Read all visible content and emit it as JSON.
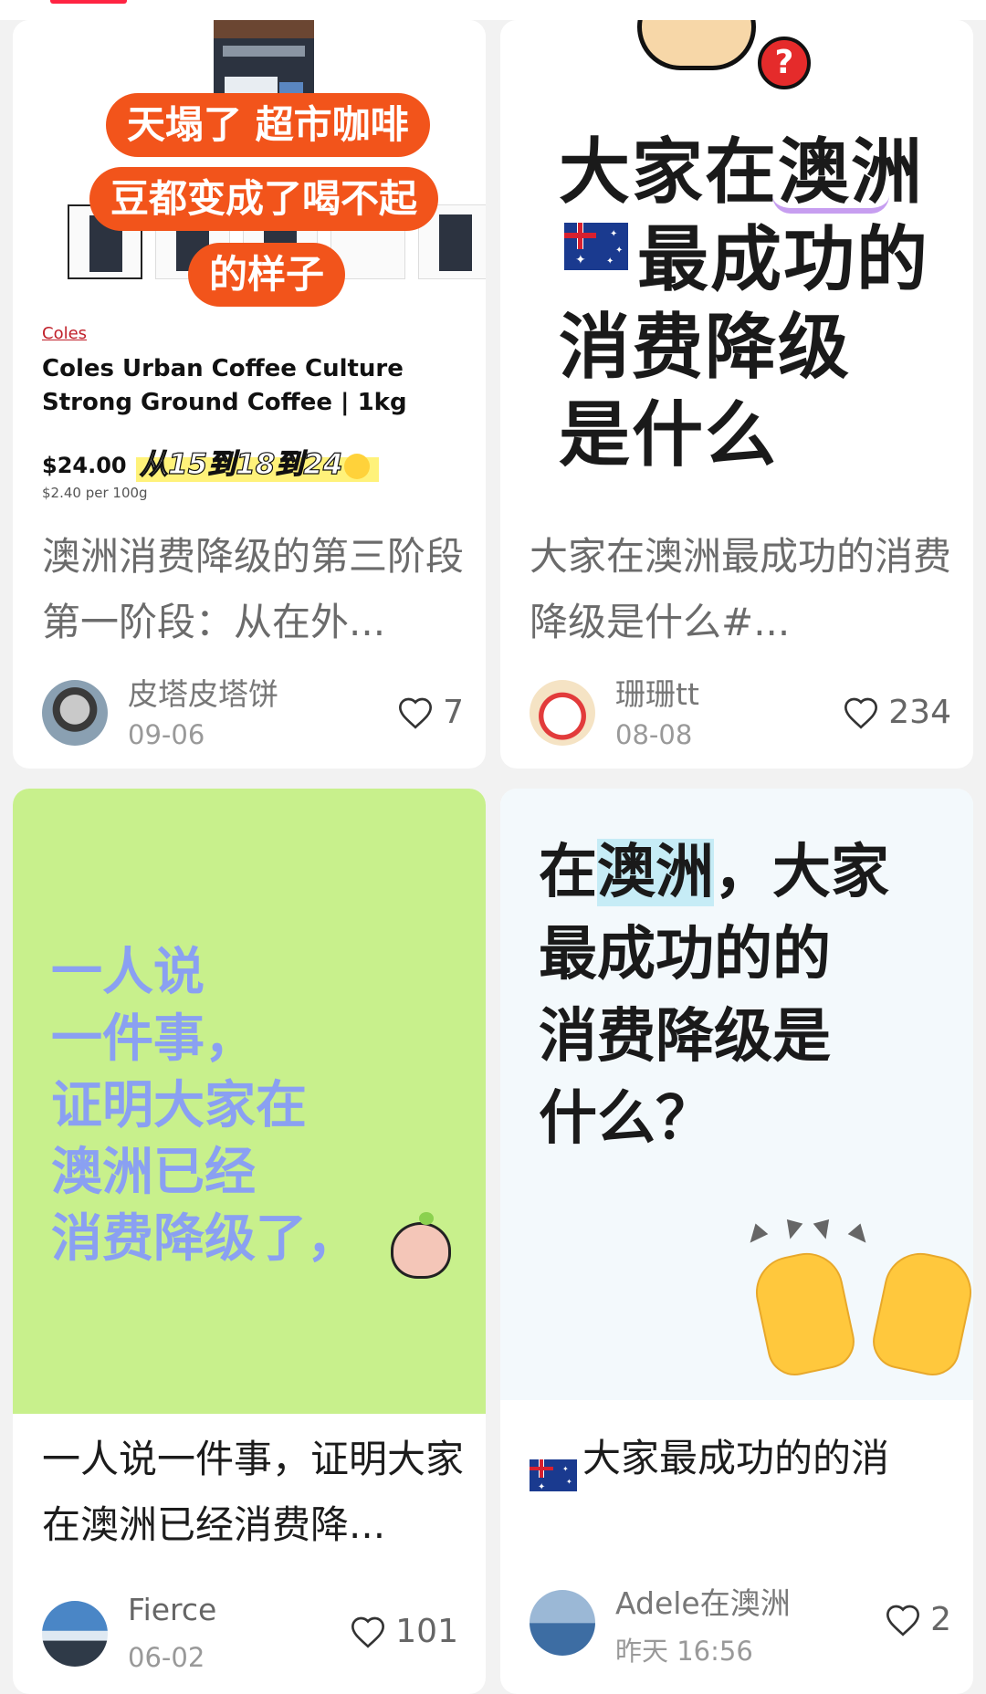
{
  "cards": [
    {
      "cover": {
        "overlay_lines": [
          "天塌了 超市咖啡",
          "豆都变成了喝不起",
          "的样子"
        ],
        "store_link": "Coles",
        "product_name": "Coles Urban Coffee Culture Strong Ground Coffee | 1kg",
        "price": "$24.00",
        "unit_price": "$2.40 per 100g",
        "handwritten_note": "从15到18到24"
      },
      "title": "澳洲消费降级的第三阶段 第一阶段：从在外...",
      "author": "皮塔皮塔饼",
      "date": "09-06",
      "likes": "7",
      "avatar_icon": "dog-avatar"
    },
    {
      "cover": {
        "lines": [
          "大家在澳洲",
          "最成功的",
          "消费降级",
          "是什么"
        ],
        "badge": "?"
      },
      "title": "大家在澳洲最成功的消费降级是什么#...",
      "author": "珊珊tt",
      "date": "08-08",
      "likes": "234",
      "avatar_icon": "hello-kitty-avatar"
    },
    {
      "cover": {
        "lines": [
          "一人说",
          "一件事，",
          "证明大家在",
          "澳洲已经",
          "消费降级了，"
        ]
      },
      "title": "一人说一件事，证明大家在澳洲已经消费降...",
      "author": "Fierce",
      "date": "06-02",
      "likes": "101",
      "avatar_icon": "landscape-avatar"
    },
    {
      "cover": {
        "line1_highlight": "澳洲",
        "line1_pre": "在",
        "line1_post": "，大家",
        "lines_rest": [
          "最成功的的",
          "消费降级是",
          "什么？"
        ]
      },
      "title": "大家最成功的的消费降级是什么！？ ...",
      "author": "Adele在澳洲",
      "date": "昨天 16:56",
      "likes": "2",
      "avatar_icon": "beach-cat-avatar"
    }
  ],
  "colors": {
    "accent": "#ff2442",
    "overlay_orange": "#f2541b",
    "green_bg": "#c8f08c",
    "blue_text": "#8aa0f2"
  }
}
